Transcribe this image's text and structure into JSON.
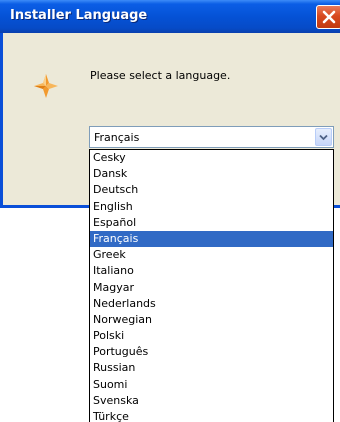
{
  "window": {
    "title": "Installer Language",
    "close_icon": "close-icon",
    "icon": "installer-diamond-icon"
  },
  "dialog": {
    "prompt": "Please select a language."
  },
  "language_select": {
    "value": "Français",
    "arrow_icon": "chevron-down-icon",
    "options": [
      "Cesky",
      "Dansk",
      "Deutsch",
      "English",
      "Español",
      "Français",
      "Greek",
      "Italiano",
      "Magyar",
      "Nederlands",
      "Norwegian",
      "Polski",
      "Português",
      "Russian",
      "Suomi",
      "Svenska",
      "Türkçe"
    ],
    "highlighted": "Français"
  },
  "colors": {
    "titlebar": "#0552d6",
    "close_button": "#d8491f",
    "dialog_bg": "#ece9d8",
    "selection": "#316ac5"
  }
}
